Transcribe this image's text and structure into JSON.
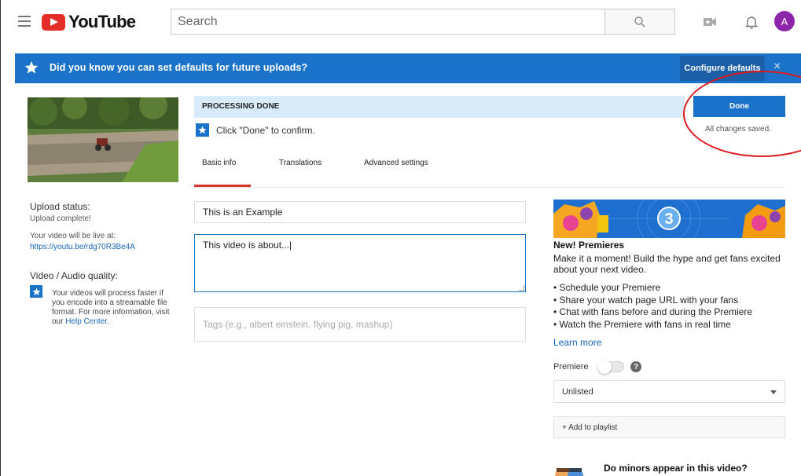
{
  "header": {
    "logo_text": "YouTube",
    "search_placeholder": "Search",
    "avatar_letter": "A"
  },
  "banner": {
    "text": "Did you know you can set defaults for future uploads?",
    "button_label": "Configure defaults",
    "close_symbol": "×"
  },
  "left": {
    "upload_status_label": "Upload status:",
    "upload_status_value": "Upload complete!",
    "live_label": "Your video will be live at:",
    "live_url": "https://youtu.be/rdg70R3Be4A",
    "quality_label": "Video / Audio quality:",
    "quality_text": "Your videos will process faster if you encode into a streamable file format. For more information, visit our ",
    "help_center_link": "Help Center."
  },
  "processing": {
    "status": "PROCESSING DONE",
    "confirm_text": "Click \"Done\" to confirm.",
    "done_label": "Done",
    "saved_text": "All changes saved."
  },
  "tabs": [
    {
      "label": "Basic info",
      "active": true
    },
    {
      "label": "Translations",
      "active": false
    },
    {
      "label": "Advanced settings",
      "active": false
    }
  ],
  "form": {
    "title_value": "This is an Example",
    "description_value": "This video is about...|",
    "tags_placeholder": "Tags (e.g., albert einstein, flying pig, mashup)"
  },
  "premieres": {
    "badge_number": "3",
    "title": "New! Premieres",
    "description": "Make it a moment! Build the hype and get fans excited about your next video.",
    "bullets": [
      "Schedule your Premiere",
      "Share your watch page URL with your fans",
      "Chat with fans before and during the Premiere",
      "Watch the Premiere with fans in real time"
    ],
    "learn_more": "Learn more",
    "premiere_label": "Premiere",
    "help_symbol": "?",
    "visibility_value": "Unlisted",
    "add_playlist_label": "+ Add to playlist",
    "minors_question": "Do minors appear in this video?"
  },
  "colors": {
    "accent_blue": "#1a73c9",
    "brand_red": "#e52d27",
    "annotation_red": "#e0191f"
  }
}
